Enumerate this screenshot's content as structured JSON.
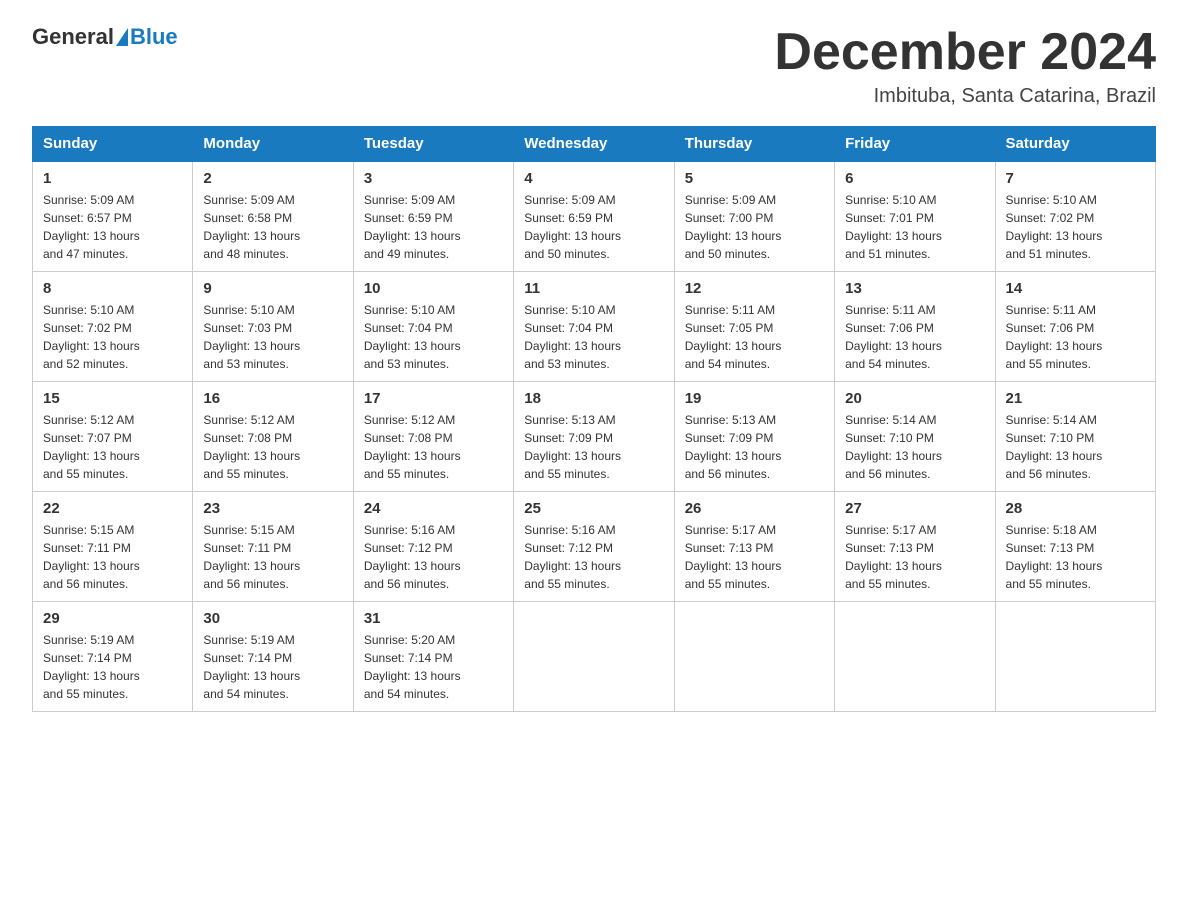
{
  "header": {
    "logo_general": "General",
    "logo_blue": "Blue",
    "month_title": "December 2024",
    "subtitle": "Imbituba, Santa Catarina, Brazil"
  },
  "days_of_week": [
    "Sunday",
    "Monday",
    "Tuesday",
    "Wednesday",
    "Thursday",
    "Friday",
    "Saturday"
  ],
  "weeks": [
    [
      {
        "day": "1",
        "sunrise": "5:09 AM",
        "sunset": "6:57 PM",
        "daylight": "13 hours and 47 minutes."
      },
      {
        "day": "2",
        "sunrise": "5:09 AM",
        "sunset": "6:58 PM",
        "daylight": "13 hours and 48 minutes."
      },
      {
        "day": "3",
        "sunrise": "5:09 AM",
        "sunset": "6:59 PM",
        "daylight": "13 hours and 49 minutes."
      },
      {
        "day": "4",
        "sunrise": "5:09 AM",
        "sunset": "6:59 PM",
        "daylight": "13 hours and 50 minutes."
      },
      {
        "day": "5",
        "sunrise": "5:09 AM",
        "sunset": "7:00 PM",
        "daylight": "13 hours and 50 minutes."
      },
      {
        "day": "6",
        "sunrise": "5:10 AM",
        "sunset": "7:01 PM",
        "daylight": "13 hours and 51 minutes."
      },
      {
        "day": "7",
        "sunrise": "5:10 AM",
        "sunset": "7:02 PM",
        "daylight": "13 hours and 51 minutes."
      }
    ],
    [
      {
        "day": "8",
        "sunrise": "5:10 AM",
        "sunset": "7:02 PM",
        "daylight": "13 hours and 52 minutes."
      },
      {
        "day": "9",
        "sunrise": "5:10 AM",
        "sunset": "7:03 PM",
        "daylight": "13 hours and 53 minutes."
      },
      {
        "day": "10",
        "sunrise": "5:10 AM",
        "sunset": "7:04 PM",
        "daylight": "13 hours and 53 minutes."
      },
      {
        "day": "11",
        "sunrise": "5:10 AM",
        "sunset": "7:04 PM",
        "daylight": "13 hours and 53 minutes."
      },
      {
        "day": "12",
        "sunrise": "5:11 AM",
        "sunset": "7:05 PM",
        "daylight": "13 hours and 54 minutes."
      },
      {
        "day": "13",
        "sunrise": "5:11 AM",
        "sunset": "7:06 PM",
        "daylight": "13 hours and 54 minutes."
      },
      {
        "day": "14",
        "sunrise": "5:11 AM",
        "sunset": "7:06 PM",
        "daylight": "13 hours and 55 minutes."
      }
    ],
    [
      {
        "day": "15",
        "sunrise": "5:12 AM",
        "sunset": "7:07 PM",
        "daylight": "13 hours and 55 minutes."
      },
      {
        "day": "16",
        "sunrise": "5:12 AM",
        "sunset": "7:08 PM",
        "daylight": "13 hours and 55 minutes."
      },
      {
        "day": "17",
        "sunrise": "5:12 AM",
        "sunset": "7:08 PM",
        "daylight": "13 hours and 55 minutes."
      },
      {
        "day": "18",
        "sunrise": "5:13 AM",
        "sunset": "7:09 PM",
        "daylight": "13 hours and 55 minutes."
      },
      {
        "day": "19",
        "sunrise": "5:13 AM",
        "sunset": "7:09 PM",
        "daylight": "13 hours and 56 minutes."
      },
      {
        "day": "20",
        "sunrise": "5:14 AM",
        "sunset": "7:10 PM",
        "daylight": "13 hours and 56 minutes."
      },
      {
        "day": "21",
        "sunrise": "5:14 AM",
        "sunset": "7:10 PM",
        "daylight": "13 hours and 56 minutes."
      }
    ],
    [
      {
        "day": "22",
        "sunrise": "5:15 AM",
        "sunset": "7:11 PM",
        "daylight": "13 hours and 56 minutes."
      },
      {
        "day": "23",
        "sunrise": "5:15 AM",
        "sunset": "7:11 PM",
        "daylight": "13 hours and 56 minutes."
      },
      {
        "day": "24",
        "sunrise": "5:16 AM",
        "sunset": "7:12 PM",
        "daylight": "13 hours and 56 minutes."
      },
      {
        "day": "25",
        "sunrise": "5:16 AM",
        "sunset": "7:12 PM",
        "daylight": "13 hours and 55 minutes."
      },
      {
        "day": "26",
        "sunrise": "5:17 AM",
        "sunset": "7:13 PM",
        "daylight": "13 hours and 55 minutes."
      },
      {
        "day": "27",
        "sunrise": "5:17 AM",
        "sunset": "7:13 PM",
        "daylight": "13 hours and 55 minutes."
      },
      {
        "day": "28",
        "sunrise": "5:18 AM",
        "sunset": "7:13 PM",
        "daylight": "13 hours and 55 minutes."
      }
    ],
    [
      {
        "day": "29",
        "sunrise": "5:19 AM",
        "sunset": "7:14 PM",
        "daylight": "13 hours and 55 minutes."
      },
      {
        "day": "30",
        "sunrise": "5:19 AM",
        "sunset": "7:14 PM",
        "daylight": "13 hours and 54 minutes."
      },
      {
        "day": "31",
        "sunrise": "5:20 AM",
        "sunset": "7:14 PM",
        "daylight": "13 hours and 54 minutes."
      },
      null,
      null,
      null,
      null
    ]
  ],
  "labels": {
    "sunrise_prefix": "Sunrise: ",
    "sunset_prefix": "Sunset: ",
    "daylight_prefix": "Daylight: "
  }
}
